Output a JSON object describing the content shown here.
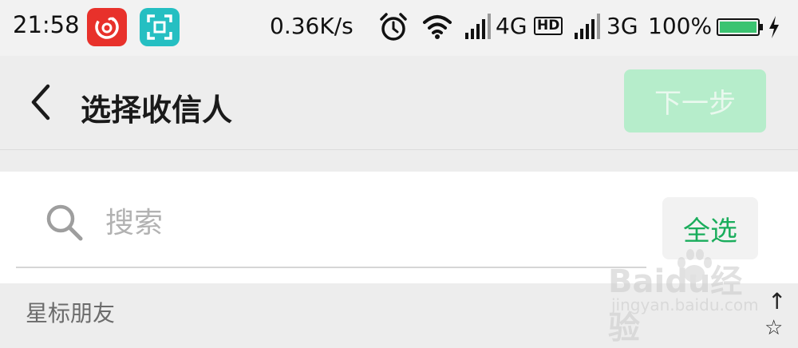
{
  "status_bar": {
    "time": "21:58",
    "net_speed": "0.36K/s",
    "network_primary": "4G",
    "hd_badge": "HD",
    "network_secondary": "3G",
    "battery_percent": "100%",
    "battery_level": 1.0,
    "colors": {
      "netease_icon": "#e8312b",
      "scanner_icon": "#25bfc2",
      "battery_fill": "#3bc371"
    },
    "icons": [
      "netease-music-icon",
      "scanner-icon",
      "alarm-clock-icon",
      "wifi-icon",
      "signal-icon",
      "hd-icon",
      "signal-icon",
      "battery-icon",
      "charging-icon"
    ]
  },
  "header": {
    "title": "选择收信人",
    "next_label": "下一步",
    "back_icon": "chevron-left-icon"
  },
  "search": {
    "placeholder": "搜索",
    "value": "",
    "select_all_label": "全选"
  },
  "section": {
    "title": "星标朋友",
    "index_arrow": "↑",
    "index_star": "☆"
  },
  "watermark": {
    "logo": "Baidu经验",
    "url": "jingyan.baidu.com"
  },
  "theme": {
    "accent_green": "#1aad5c",
    "next_button_bg": "#b6edcb",
    "page_bg": "#ededed"
  }
}
